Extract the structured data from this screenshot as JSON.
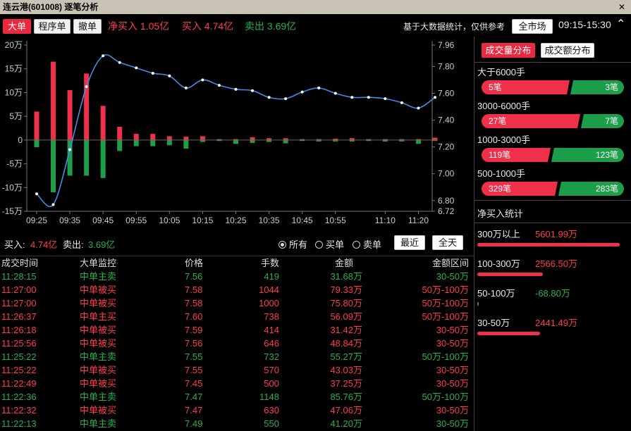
{
  "window": {
    "title": "连云港(601008) 逐笔分析",
    "close_icon": "close-icon"
  },
  "toolbar": {
    "tabs": [
      {
        "label": "大单",
        "active": true
      },
      {
        "label": "程序单",
        "active": false
      },
      {
        "label": "撤单",
        "active": false
      }
    ],
    "net_buy": "净买入 1.05亿",
    "buy": "买入 4.74亿",
    "sell": "卖出 3.69亿",
    "note": "基于大数据统计，仅供参考",
    "market_button": "全市场",
    "time_range": "09:15-15:30"
  },
  "chart_data": {
    "type": "bar+line",
    "categories": [
      "09:25",
      "09:30",
      "09:35",
      "09:40",
      "09:45",
      "09:50",
      "09:55",
      "10:00",
      "10:05",
      "10:10",
      "10:15",
      "10:20",
      "10:25",
      "10:30",
      "10:35",
      "10:40",
      "10:45",
      "10:50",
      "10:55",
      "11:00",
      "11:05",
      "11:10",
      "11:15",
      "11:20",
      "11:25"
    ],
    "buy_values": [
      6,
      16.5,
      10.5,
      14,
      7.2,
      2.8,
      1.3,
      1.3,
      0.8,
      0.7,
      0.8,
      0.2,
      0.2,
      0.6,
      0.4,
      0.4,
      0.2,
      0.2,
      0.3,
      0.4,
      0.2,
      0.2,
      0.2,
      0.2,
      0.5
    ],
    "sell_values": [
      -1.5,
      -11,
      -7.5,
      -7.5,
      -8,
      -2.3,
      -1.3,
      -1.3,
      -1.1,
      -1.8,
      -0.4,
      -0.2,
      -0.8,
      -0.6,
      -0.4,
      -0.7,
      -0.2,
      -0.3,
      -0.3,
      -0.3,
      -0.2,
      -0.3,
      -0.3,
      -0.8,
      -0.2
    ],
    "bar_colors": {
      "buy": "#f0304a",
      "sell": "#1d9e4a"
    },
    "price_series": {
      "name": "",
      "color": "#3f8fe0",
      "x": [
        "09:25",
        "09:30",
        "09:35",
        "09:40",
        "09:45",
        "09:50",
        "09:55",
        "10:00",
        "10:05",
        "10:10",
        "10:15",
        "10:20",
        "10:25",
        "10:30",
        "10:35",
        "10:40",
        "10:45",
        "10:50",
        "10:55",
        "11:00",
        "11:05",
        "11:10",
        "11:15",
        "11:20",
        "11:25"
      ],
      "values": [
        6.85,
        6.77,
        7.18,
        7.65,
        7.88,
        7.83,
        7.79,
        7.75,
        7.73,
        7.64,
        7.7,
        7.66,
        7.63,
        7.62,
        7.57,
        7.56,
        7.61,
        7.64,
        7.6,
        7.57,
        7.57,
        7.56,
        7.53,
        7.49,
        7.57
      ]
    },
    "y_left": {
      "ticks": [
        "20万",
        "15万",
        "10万",
        "5万",
        "0",
        "-5万",
        "-10万",
        "-15万"
      ],
      "range": [
        -15,
        20
      ]
    },
    "y_right": {
      "ticks": [
        "7.96",
        "7.80",
        "7.60",
        "7.40",
        "7.20",
        "7.00",
        "6.80",
        "6.72"
      ],
      "range": [
        6.72,
        7.96
      ]
    },
    "x_ticks": [
      "09:25",
      "09:35",
      "09:45",
      "09:55",
      "10:05",
      "10:15",
      "10:25",
      "10:35",
      "10:45",
      "10:55",
      "11:10",
      "11:20"
    ]
  },
  "summary": {
    "buy_label": "买入:",
    "buy_value": "4.74亿",
    "sell_label": "卖出:",
    "sell_value": "3.69亿",
    "filters": [
      {
        "label": "所有",
        "selected": true
      },
      {
        "label": "买单",
        "selected": false
      },
      {
        "label": "卖单",
        "selected": false
      }
    ],
    "recent_button": "最近",
    "allday_button": "全天"
  },
  "table": {
    "headers": [
      "成交时间",
      "大单监控",
      "价格",
      "手数",
      "金额",
      "金额区间"
    ],
    "rows": [
      {
        "time": "11:28:15",
        "type": "中单主卖",
        "price": "7.56",
        "lots": "419",
        "amount": "31.68万",
        "range": "30-50万",
        "side": "sell"
      },
      {
        "time": "11:27:00",
        "type": "中单被买",
        "price": "7.58",
        "lots": "1044",
        "amount": "79.33万",
        "range": "50万-100万",
        "side": "buy"
      },
      {
        "time": "11:27:00",
        "type": "中单被买",
        "price": "7.58",
        "lots": "1000",
        "amount": "75.80万",
        "range": "50万-100万",
        "side": "buy"
      },
      {
        "time": "11:26:37",
        "type": "中单主买",
        "price": "7.60",
        "lots": "738",
        "amount": "56.09万",
        "range": "50万-100万",
        "side": "buy"
      },
      {
        "time": "11:26:18",
        "type": "中单被买",
        "price": "7.59",
        "lots": "414",
        "amount": "31.42万",
        "range": "30-50万",
        "side": "buy"
      },
      {
        "time": "11:25:56",
        "type": "中单被买",
        "price": "7.56",
        "lots": "646",
        "amount": "48.84万",
        "range": "30-50万",
        "side": "buy"
      },
      {
        "time": "11:25:22",
        "type": "中单主卖",
        "price": "7.55",
        "lots": "732",
        "amount": "55.27万",
        "range": "50万-100万",
        "side": "sell"
      },
      {
        "time": "11:25:22",
        "type": "中单被买",
        "price": "7.55",
        "lots": "570",
        "amount": "43.03万",
        "range": "30-50万",
        "side": "buy"
      },
      {
        "time": "11:22:49",
        "type": "中单被买",
        "price": "7.45",
        "lots": "500",
        "amount": "37.25万",
        "range": "30-50万",
        "side": "buy"
      },
      {
        "time": "11:22:36",
        "type": "中单主卖",
        "price": "7.47",
        "lots": "1148",
        "amount": "85.76万",
        "range": "50万-100万",
        "side": "sell"
      },
      {
        "time": "11:22:32",
        "type": "中单被买",
        "price": "7.47",
        "lots": "630",
        "amount": "47.06万",
        "range": "30-50万",
        "side": "buy"
      },
      {
        "time": "11:22:13",
        "type": "中单主卖",
        "price": "7.49",
        "lots": "550",
        "amount": "41.20万",
        "range": "30-50万",
        "side": "sell"
      }
    ]
  },
  "right_panel": {
    "tabs": [
      {
        "label": "成交量分布",
        "active": true
      },
      {
        "label": "成交额分布",
        "active": false
      }
    ],
    "distribution": [
      {
        "label": "大于6000手",
        "buy": "5笔",
        "sell": "3笔",
        "buy_n": 5,
        "sell_n": 3
      },
      {
        "label": "3000-6000手",
        "buy": "27笔",
        "sell": "7笔",
        "buy_n": 27,
        "sell_n": 7
      },
      {
        "label": "1000-3000手",
        "buy": "119笔",
        "sell": "123笔",
        "buy_n": 119,
        "sell_n": 123
      },
      {
        "label": "500-1000手",
        "buy": "329笔",
        "sell": "283笔",
        "buy_n": 329,
        "sell_n": 283
      }
    ],
    "net_title": "净买入统计",
    "net_stats": [
      {
        "label": "300万以上",
        "value": "5601.99万",
        "color": "#ff3b4b",
        "fraction": 1.0
      },
      {
        "label": "100-300万",
        "value": "2566.50万",
        "color": "#ff3b4b",
        "fraction": 0.46
      },
      {
        "label": "50-100万",
        "value": "-68.80万",
        "color": "#27b04a",
        "fraction": 0.012
      },
      {
        "label": "30-50万",
        "value": "2441.49万",
        "color": "#ff3b4b",
        "fraction": 0.44
      }
    ]
  }
}
